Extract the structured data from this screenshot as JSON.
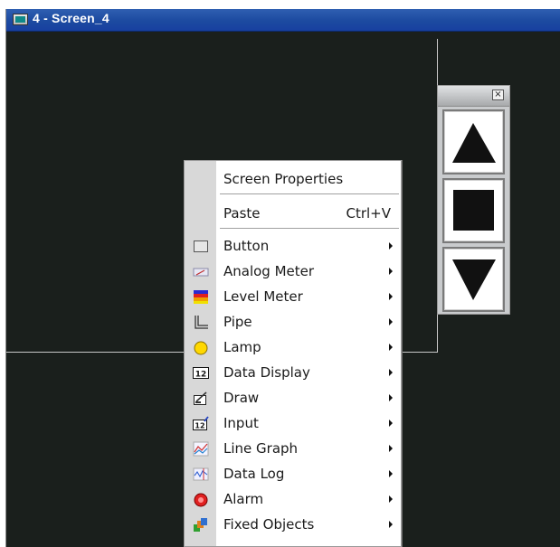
{
  "window": {
    "title": "4 - Screen_4"
  },
  "toolbar": {
    "close_label": "×",
    "buttons": [
      {
        "name": "up-arrow-button"
      },
      {
        "name": "stop-button"
      },
      {
        "name": "down-arrow-button"
      }
    ]
  },
  "menu": {
    "items": [
      {
        "label": "Screen Properties",
        "icon": "",
        "submenu": false
      },
      {
        "label": "Paste",
        "shortcut": "Ctrl+V",
        "icon": "",
        "submenu": false
      },
      {
        "label": "Button",
        "icon": "button-icon",
        "submenu": true
      },
      {
        "label": "Analog Meter",
        "icon": "analog-meter-icon",
        "submenu": true
      },
      {
        "label": "Level Meter",
        "icon": "level-meter-icon",
        "submenu": true
      },
      {
        "label": "Pipe",
        "icon": "pipe-icon",
        "submenu": true
      },
      {
        "label": "Lamp",
        "icon": "lamp-icon",
        "submenu": true
      },
      {
        "label": "Data Display",
        "icon": "data-display-icon",
        "submenu": true
      },
      {
        "label": "Draw",
        "icon": "draw-icon",
        "submenu": true
      },
      {
        "label": "Input",
        "icon": "input-icon",
        "submenu": true
      },
      {
        "label": "Line Graph",
        "icon": "line-graph-icon",
        "submenu": true
      },
      {
        "label": "Data Log",
        "icon": "data-log-icon",
        "submenu": true
      },
      {
        "label": "Alarm",
        "icon": "alarm-icon",
        "submenu": true
      },
      {
        "label": "Fixed Objects",
        "icon": "fixed-objects-icon",
        "submenu": true
      }
    ],
    "icon_text": {
      "data_display": "12",
      "input": "12"
    }
  },
  "colors": {
    "canvas": "#1a1f1c",
    "titlebar": "#1c4aa0",
    "menu_strip": "#d8d8d8"
  }
}
